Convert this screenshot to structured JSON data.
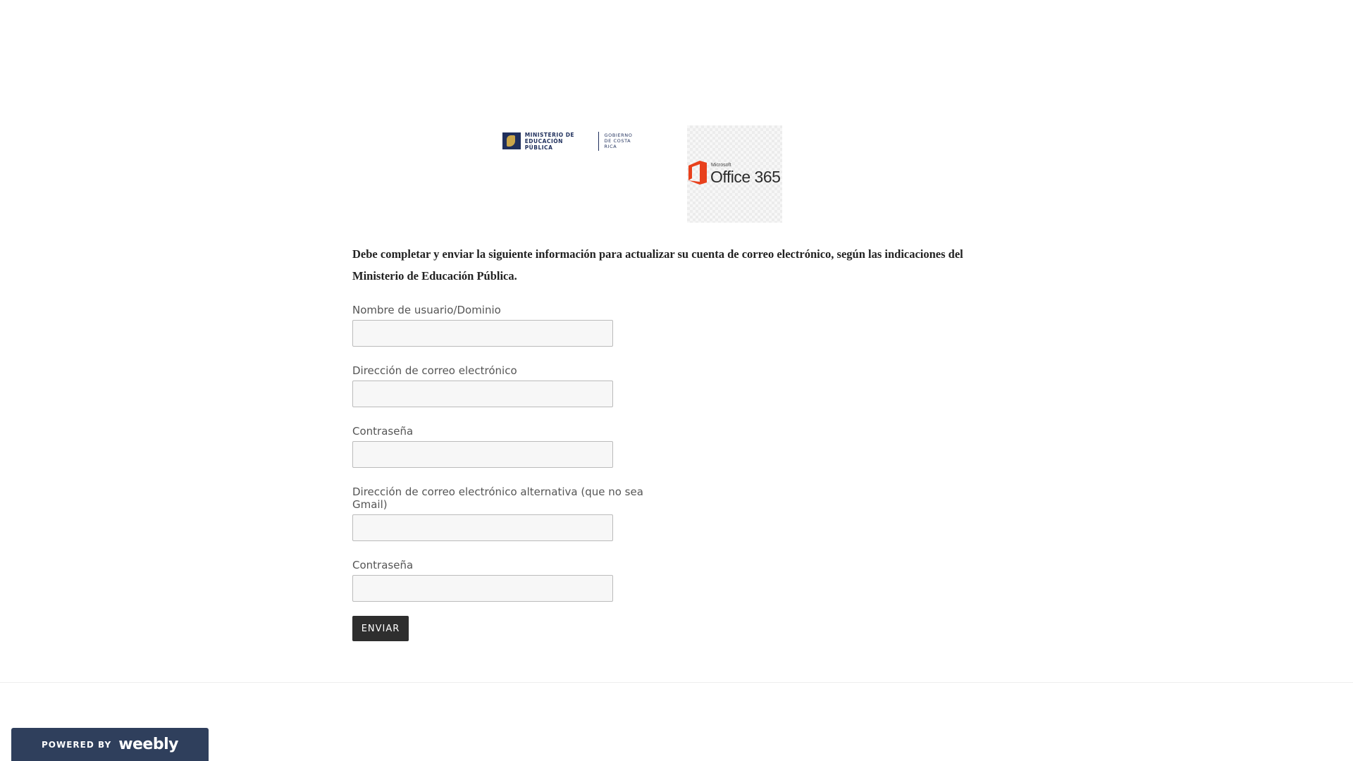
{
  "logos": {
    "mep_name": "MINISTERIO DE\nEDUCACIÓN PÚBLICA",
    "mep_gov": "GOBIERNO\nDE COSTA RICA",
    "office_brand": "Microsoft",
    "office_name": "Office 365"
  },
  "intro_text": "Debe completar y enviar la siguiente información para actualizar su cuenta de correo electrónico, según las indicaciones del Ministerio de Educación Pública.",
  "form": {
    "fields": [
      {
        "label": "Nombre de usuario/Dominio",
        "value": ""
      },
      {
        "label": "Dirección de correo electrónico",
        "value": ""
      },
      {
        "label": "Contraseña",
        "value": ""
      },
      {
        "label": "Dirección de correo electrónico alternativa (que no sea Gmail)",
        "value": ""
      },
      {
        "label": "Contraseña",
        "value": ""
      }
    ],
    "submit_label": "ENVIAR"
  },
  "footer": {
    "powered_by": "POWERED BY",
    "brand": "weebly"
  },
  "colors": {
    "button_bg": "#2e2e2e",
    "badge_bg": "#2f3f5c",
    "office_orange": "#e8401c",
    "mep_navy": "#1f2f5c"
  }
}
